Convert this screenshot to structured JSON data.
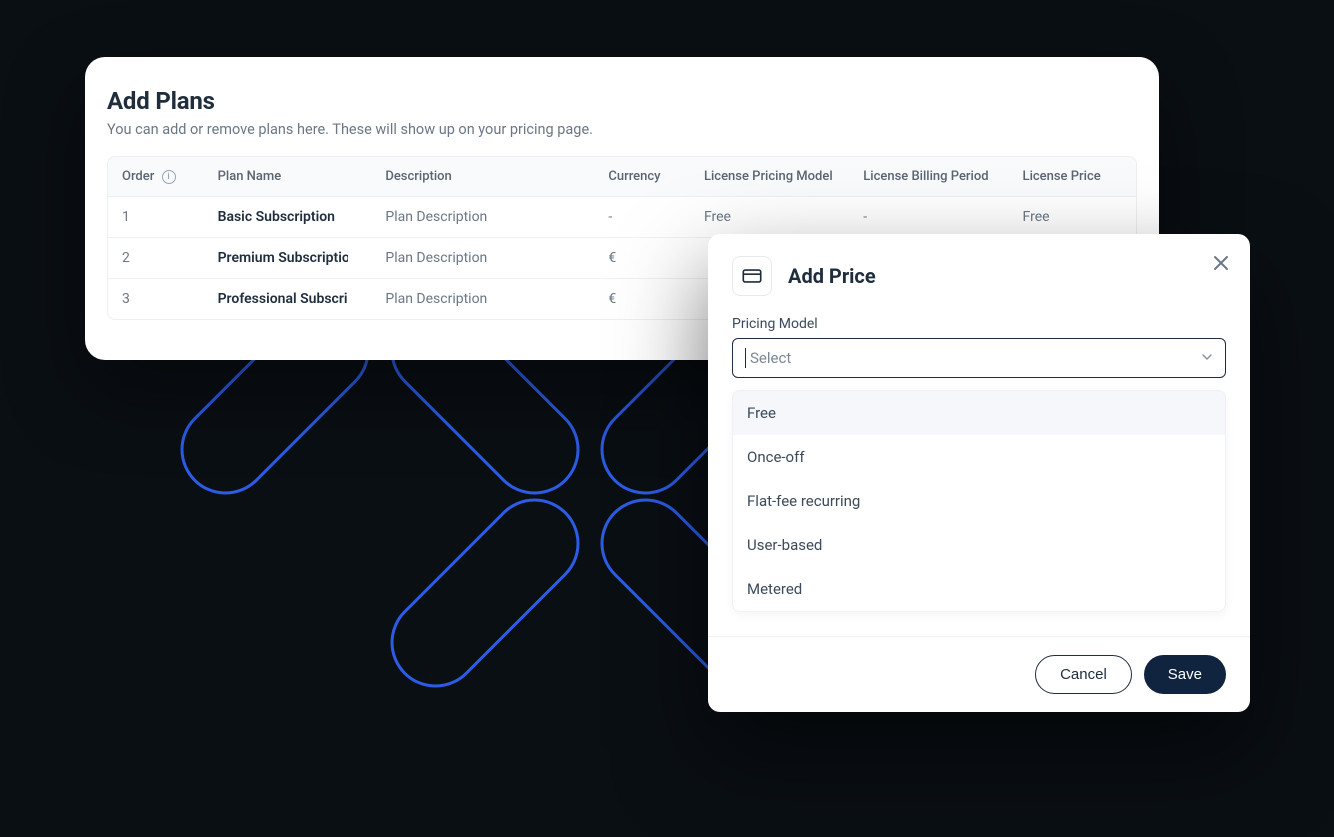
{
  "plans_panel": {
    "title": "Add Plans",
    "subtitle": "You can add or remove plans here. These will show up on your pricing page.",
    "columns": {
      "order": "Order",
      "plan_name": "Plan Name",
      "description": "Description",
      "currency": "Currency",
      "license_pricing_model": "License Pricing Model",
      "license_billing_period": "License Billing Period",
      "license_price": "License Price"
    },
    "rows": [
      {
        "order": "1",
        "plan_name": "Basic Subscription",
        "description": "Plan Description",
        "currency": "-",
        "license_pricing_model": "Free",
        "license_billing_period": "-",
        "license_price": "Free"
      },
      {
        "order": "2",
        "plan_name": "Premium Subscription",
        "description": "Plan Description",
        "currency": "€",
        "license_pricing_model": "",
        "license_billing_period": "",
        "license_price": ""
      },
      {
        "order": "3",
        "plan_name": "Professional Subscription",
        "description": "Plan Description",
        "currency": "€",
        "license_pricing_model": "",
        "license_billing_period": "",
        "license_price": ""
      }
    ]
  },
  "modal": {
    "title": "Add Price",
    "field_label": "Pricing Model",
    "select_placeholder": "Select",
    "options": [
      "Free",
      "Once-off",
      "Flat-fee recurring",
      "User-based",
      "Metered"
    ],
    "cancel": "Cancel",
    "save": "Save"
  }
}
